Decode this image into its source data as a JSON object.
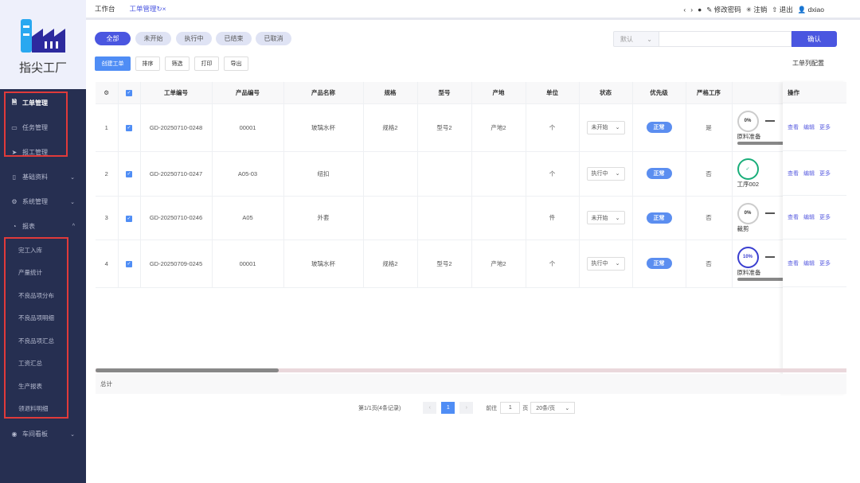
{
  "app": {
    "name": "指尖工厂"
  },
  "sidebar": {
    "items": [
      {
        "label": "工单管理",
        "icon": "document-icon",
        "active": true
      },
      {
        "label": "任务管理",
        "icon": "monitor-icon"
      },
      {
        "label": "报工管理",
        "icon": "send-icon"
      },
      {
        "label": "基础资料",
        "icon": "book-icon",
        "chevron": "down"
      },
      {
        "label": "系统管理",
        "icon": "gear-icon",
        "chevron": "down"
      },
      {
        "label": "报表",
        "icon": "pie-chart-icon",
        "chevron": "up"
      }
    ],
    "report_items": [
      "完工入库",
      "产量统计",
      "不良品项分布",
      "不良品项明细",
      "不良品项汇总",
      "工资汇总",
      "生产报表",
      "领退料明细"
    ],
    "bottom": {
      "label": "车间看板",
      "icon": "eye-icon"
    }
  },
  "tabs": [
    {
      "label": "工作台"
    },
    {
      "label": "工单管理",
      "active": true
    }
  ],
  "topbar": {
    "change_password": "修改密码",
    "cancel": "注销",
    "logout": "退出",
    "user": "dxiao"
  },
  "filters": [
    "全部",
    "未开始",
    "执行中",
    "已结束",
    "已取消"
  ],
  "search": {
    "select": "默认",
    "placeholder": "",
    "confirm": "确认"
  },
  "actions": [
    "创建工单",
    "排序",
    "筛选",
    "打印",
    "导出"
  ],
  "column_config": "工单列配置",
  "table": {
    "headers": [
      "工单编号",
      "产品编号",
      "产品名称",
      "规格",
      "型号",
      "产地",
      "单位",
      "状态",
      "优先级",
      "严格工序",
      "",
      "操作"
    ],
    "rows": [
      {
        "no": "1",
        "order": "GD-20250710-0248",
        "code": "00001",
        "name": "玻璃水杯",
        "spec": "规格2",
        "model": "型号2",
        "origin": "产地2",
        "unit": "个",
        "status": "未开始",
        "priority": "正常",
        "strict": "是",
        "step": "原料准备",
        "pct": "0%",
        "color": "#cccccc"
      },
      {
        "no": "2",
        "order": "GD-20250710-0247",
        "code": "A05-03",
        "name": "纽扣",
        "spec": "",
        "model": "",
        "origin": "",
        "unit": "个",
        "status": "执行中",
        "priority": "正常",
        "strict": "否",
        "step": "工序002",
        "pct": "✓",
        "color": "#1aae7a"
      },
      {
        "no": "3",
        "order": "GD-20250710-0246",
        "code": "A05",
        "name": "外套",
        "spec": "",
        "model": "",
        "origin": "",
        "unit": "件",
        "status": "未开始",
        "priority": "正常",
        "strict": "否",
        "step": "裁剪",
        "pct": "0%",
        "color": "#cccccc"
      },
      {
        "no": "4",
        "order": "GD-20250709-0245",
        "code": "00001",
        "name": "玻璃水杯",
        "spec": "规格2",
        "model": "型号2",
        "origin": "产地2",
        "unit": "个",
        "status": "执行中",
        "priority": "正常",
        "strict": "否",
        "step": "原料准备",
        "pct": "10%",
        "color": "#3a3fd0"
      }
    ],
    "row_actions": [
      "查看",
      "编辑",
      "更多"
    ],
    "total": "总计"
  },
  "pagination": {
    "summary": "第1/1页(4条记录)",
    "current": "1",
    "goto_label": "前往",
    "goto_value": "1",
    "page_unit": "页",
    "page_size": "20条/页"
  },
  "colors": {
    "accent": "#4a56e0",
    "sidebar": "#262f51"
  }
}
